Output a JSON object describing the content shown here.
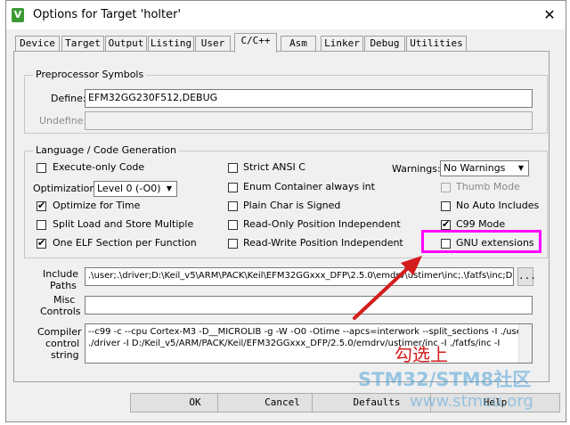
{
  "window": {
    "title": "Options for Target 'holter'",
    "icon": "keil-app-icon",
    "close_glyph": "✕"
  },
  "tabs": [
    {
      "label": "Device"
    },
    {
      "label": "Target"
    },
    {
      "label": "Output"
    },
    {
      "label": "Listing"
    },
    {
      "label": "User"
    },
    {
      "label": "C/C++",
      "active": true
    },
    {
      "label": "Asm"
    },
    {
      "label": "Linker"
    },
    {
      "label": "Debug"
    },
    {
      "label": "Utilities"
    }
  ],
  "preprocessor": {
    "legend": "Preprocessor Symbols",
    "define_label": "Define:",
    "define_value": "EFM32GG230F512,DEBUG",
    "undefine_label": "Undefine:",
    "undefine_value": ""
  },
  "language": {
    "legend": "Language / Code Generation",
    "execute_only": {
      "label": "Execute-only Code",
      "checked": false
    },
    "optimization_label": "Optimization:",
    "optimization_value": "Level 0 (-O0)",
    "optimize_time": {
      "label": "Optimize for Time",
      "checked": true
    },
    "split_load": {
      "label": "Split Load and Store Multiple",
      "checked": false
    },
    "one_elf": {
      "label": "One ELF Section per Function",
      "checked": true
    },
    "strict_ansi": {
      "label": "Strict ANSI C",
      "checked": false
    },
    "enum_container": {
      "label": "Enum Container always int",
      "checked": false
    },
    "plain_char": {
      "label": "Plain Char is Signed",
      "checked": false
    },
    "ro_pi": {
      "label": "Read-Only Position Independent",
      "checked": false
    },
    "rw_pi": {
      "label": "Read-Write Position Independent",
      "checked": false
    },
    "warnings_label": "Warnings:",
    "warnings_value": "No Warnings",
    "thumb_mode": {
      "label": "Thumb Mode",
      "checked": false,
      "disabled": true
    },
    "no_auto_includes": {
      "label": "No Auto Includes",
      "checked": false
    },
    "c99_mode": {
      "label": "C99 Mode",
      "checked": true
    },
    "gnu_extensions": {
      "label": "GNU extensions",
      "checked": false
    }
  },
  "include_paths": {
    "label_line1": "Include",
    "label_line2": "Paths",
    "value": ".\\user;.\\driver;D:\\Keil_v5\\ARM\\PACK\\Keil\\EFM32GGxxx_DFP\\2.5.0\\emdrv\\ustimer\\inc;.\\fatfs\\inc;D",
    "browse_label": "..."
  },
  "misc_controls": {
    "label_line1": "Misc",
    "label_line2": "Controls",
    "value": ""
  },
  "compiler_control": {
    "label_line1": "Compiler",
    "label_line2": "control",
    "label_line3": "string",
    "line1": "--c99 -c --cpu Cortex-M3 -D__MICROLIB -g -W -O0 -Otime --apcs=interwork --split_sections -I ./user -I",
    "line2": "./driver -I D:/Keil_v5/ARM/PACK/Keil/EFM32GGxxx_DFP/2.5.0/emdrv/ustimer/inc -I ./fatfs/inc -I"
  },
  "buttons": {
    "ok": "OK",
    "cancel": "Cancel",
    "defaults": "Defaults",
    "help": "Help"
  },
  "annotation": {
    "text": "勾选上",
    "highlight_color": "#ff00ff",
    "arrow_color": "#d31c1c"
  },
  "watermark": {
    "line1": "STM32/STM8社区",
    "line2": "www.stmcu.org"
  },
  "colors": {
    "dialog_bg": "#f0f0f0",
    "app_icon": "#3c9a34",
    "watermark": "#4fa3d8"
  }
}
